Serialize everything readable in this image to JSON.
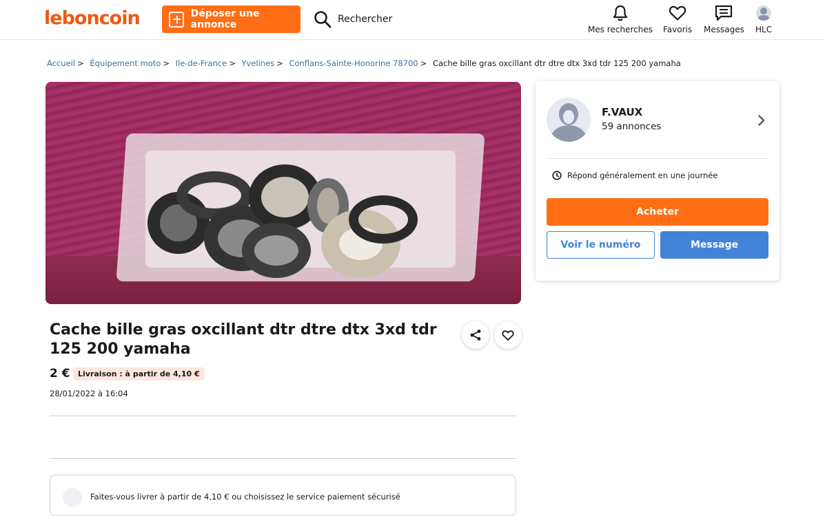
{
  "header": {
    "logo": "leboncoin",
    "deposer_label": "Déposer une annonce",
    "search_label": "Rechercher",
    "nav": {
      "recherches": "Mes recherches",
      "favoris": "Favoris",
      "messages": "Messages",
      "user": "HLC"
    }
  },
  "breadcrumb": [
    "Accueil",
    "Équipement moto",
    "Ile-de-France",
    "Yvelines",
    "Conflans-Sainte-Honorine 78700",
    "Cache bille gras oxcillant dtr dtre dtx 3xd tdr 125 200 yamaha"
  ],
  "listing": {
    "title": "Cache bille gras oxcillant dtr dtre dtx 3xd tdr 125 200 yamaha",
    "price": "2 €",
    "livraison": "Livraison : à partir de 4,10 €",
    "date": "28/01/2022 à 16:04",
    "delivery_text": "Faites-vous livrer à partir de 4,10 € ou choisissez le service paiement sécurisé"
  },
  "seller": {
    "name": "F.VAUX",
    "count": "59 annonces",
    "response": "Répond généralement en une journée",
    "acheter_label": "Acheter",
    "numero_label": "Voir le numéro",
    "message_label": "Message"
  },
  "colors": {
    "brand_orange": "#ff6e14",
    "logo_orange": "#ec5a13",
    "action_blue": "#4183d7"
  },
  "icons": [
    "plus-square-icon",
    "search-icon",
    "bell-icon",
    "heart-icon",
    "message-icon",
    "avatar",
    "chevron-right-icon",
    "clock-icon",
    "share-icon",
    "package-icon"
  ]
}
